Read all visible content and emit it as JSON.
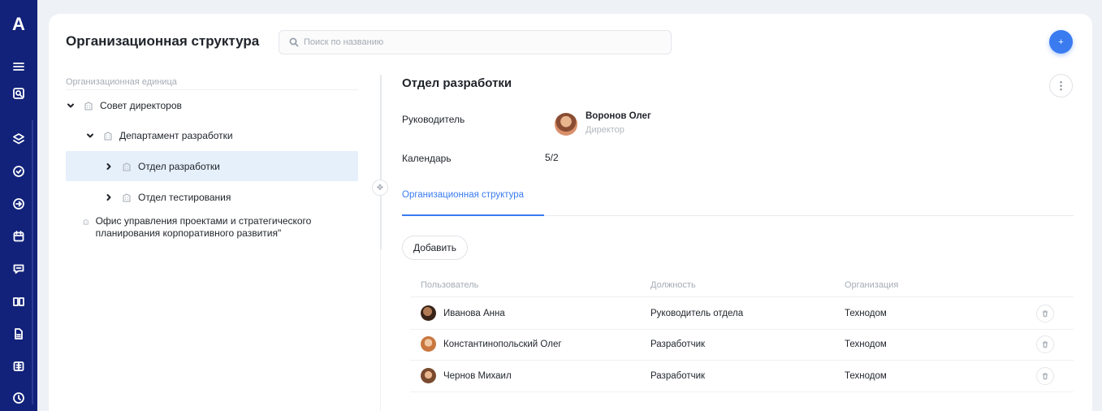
{
  "app": {
    "logo": "A"
  },
  "header": {
    "title": "Организационная структура",
    "search_placeholder": "Поиск по названию",
    "add_button": "+"
  },
  "tree": {
    "column_header": "Организационная единица",
    "nodes": [
      {
        "label": "Совет директоров",
        "expanded": true
      },
      {
        "label": "Департамент разработки",
        "expanded": true
      },
      {
        "label": "Отдел разработки",
        "expanded": false,
        "selected": true
      },
      {
        "label": "Отдел тестирования",
        "expanded": false
      },
      {
        "label": "Офис управления проектами и стратегического планирования корпоративного развития\""
      }
    ]
  },
  "detail": {
    "title": "Отдел разработки",
    "more_button": "⋮",
    "manager_label": "Руководитель",
    "manager_name": "Воронов Олег",
    "manager_role": "Директор",
    "calendar_label": "Календарь",
    "calendar_value": "5/2",
    "tab_label": "Организационная структура",
    "add_label": "Добавить",
    "table": {
      "headers": [
        "Пользователь",
        "Должность",
        "Организация"
      ],
      "rows": [
        {
          "user": "Иванова Анна",
          "position": "Руководитель отдела",
          "org": "Технодом"
        },
        {
          "user": "Константинопольский Олег",
          "position": "Разработчик",
          "org": "Технодом"
        },
        {
          "user": "Чернов Михаил",
          "position": "Разработчик",
          "org": "Технодом"
        }
      ]
    }
  },
  "colors": {
    "sidebar": "#12227a",
    "accent": "#3a7bf0",
    "selected_row": "#e6f0fb"
  }
}
